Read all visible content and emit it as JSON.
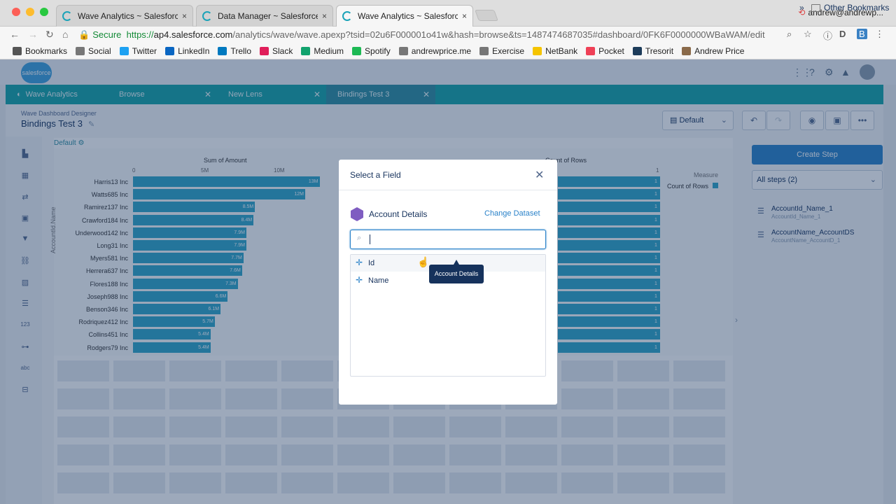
{
  "browser": {
    "tabs": [
      {
        "label": "Wave Analytics ~ Salesforce - "
      },
      {
        "label": "Data Manager ~ Salesforce - D"
      },
      {
        "label": "Wave Analytics ~ Salesforce - "
      }
    ],
    "tab_close": "×",
    "user": "andrew@andrewp...",
    "secure_label": "Secure",
    "url_scheme": "https://",
    "url_host": "ap4.salesforce.com",
    "url_path": "/analytics/wave/wave.apexp?tsid=02u6F000001o41w&hash=browse&ts=1487474687035#dashboard/0FK6F0000000WBaWAM/edit",
    "bookmarks": [
      {
        "label": "Bookmarks",
        "icon": "star-icon",
        "color": "#555555"
      },
      {
        "label": "Social",
        "icon": "folder-icon",
        "color": "#777777"
      },
      {
        "label": "Twitter",
        "icon": "twitter-icon",
        "color": "#1da1f2"
      },
      {
        "label": "LinkedIn",
        "icon": "linkedin-icon",
        "color": "#0a66c2"
      },
      {
        "label": "Trello",
        "icon": "trello-icon",
        "color": "#0079bf"
      },
      {
        "label": "Slack",
        "icon": "slack-icon",
        "color": "#e01e5a"
      },
      {
        "label": "Medium",
        "icon": "medium-icon",
        "color": "#12a36e"
      },
      {
        "label": "Spotify",
        "icon": "spotify-icon",
        "color": "#1db954"
      },
      {
        "label": "andrewprice.me",
        "icon": "folder-icon",
        "color": "#777777"
      },
      {
        "label": "Exercise",
        "icon": "folder-icon",
        "color": "#777777"
      },
      {
        "label": "NetBank",
        "icon": "netbank-icon",
        "color": "#f5c400"
      },
      {
        "label": "Pocket",
        "icon": "pocket-icon",
        "color": "#ef4056"
      },
      {
        "label": "Tresorit",
        "icon": "tresorit-icon",
        "color": "#1d3c5a"
      },
      {
        "label": "Andrew Price",
        "icon": "person-icon",
        "color": "#8a6a4a"
      }
    ],
    "bookmarks_more": "»",
    "other_bookmarks": "Other Bookmarks"
  },
  "app": {
    "logo": "salesforce",
    "tabs": [
      {
        "label": "Wave Analytics"
      },
      {
        "label": "Browse"
      },
      {
        "label": "New Lens"
      },
      {
        "label": "Bindings Test 3"
      }
    ],
    "designer_label": "Wave Dashboard Designer",
    "dashboard_title": "Bindings Test 3",
    "layout": "Default",
    "page_label": "Default ⚙"
  },
  "chart": {
    "left_title": "Sum of Amount",
    "right_title": "Count of Rows",
    "y_axis_label": "AccountId.Name",
    "ticks": [
      "0",
      "5M",
      "10M"
    ],
    "right_tick": "1",
    "legend_title": "Measure",
    "legend_item": "Count of Rows",
    "series_color": "#2fa5c9"
  },
  "chart_data": {
    "type": "bar",
    "categories": [
      "Harris13 Inc",
      "Watts685 Inc",
      "Ramirez137 Inc",
      "Crawford184 Inc",
      "Underwood142 Inc",
      "Long31 Inc",
      "Myers581 Inc",
      "Herrera637 Inc",
      "Flores188 Inc",
      "Joseph988 Inc",
      "Benson346 Inc",
      "Rodriquez412 Inc",
      "Collins451 Inc",
      "Rodgers79 Inc"
    ],
    "series": [
      {
        "name": "Sum of Amount",
        "values": [
          13,
          12,
          8.5,
          8.4,
          7.9,
          7.9,
          7.7,
          7.6,
          7.3,
          6.6,
          6.1,
          5.7,
          5.4,
          5.4
        ],
        "labels": [
          "13M",
          "12M",
          "8.5M",
          "8.4M",
          "7.9M",
          "7.9M",
          "7.7M",
          "7.6M",
          "7.3M",
          "6.6M",
          "6.1M",
          "5.7M",
          "5.4M",
          "5.4M"
        ]
      },
      {
        "name": "Count of Rows",
        "values": [
          1,
          1,
          1,
          1,
          1,
          1,
          1,
          1,
          1,
          1,
          1,
          1,
          1,
          1
        ]
      }
    ],
    "xlabel": "Sum of Amount",
    "ylabel": "AccountId.Name",
    "xlim": [
      0,
      14
    ]
  },
  "right_panel": {
    "create_step": "Create Step",
    "steps_filter": "All steps (2)",
    "steps": [
      {
        "name": "AccountId_Name_1",
        "sub": "AccountId_Name_1"
      },
      {
        "name": "AccountName_AccountDS",
        "sub": "AccountName_AccountD_1"
      }
    ]
  },
  "modal": {
    "title": "Select a Field",
    "close": "✕",
    "dataset_name": "Account Details",
    "change_dataset": "Change Dataset",
    "search_value": "",
    "fields": [
      {
        "label": "Id"
      },
      {
        "label": "Name"
      }
    ],
    "tooltip": "Account Details"
  }
}
